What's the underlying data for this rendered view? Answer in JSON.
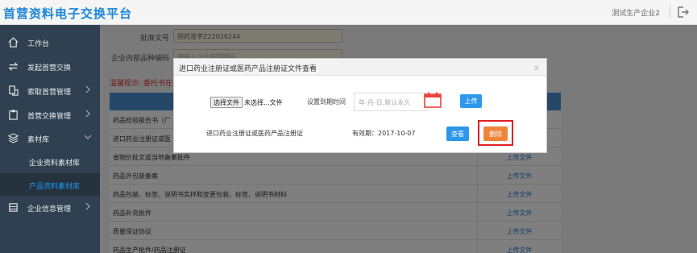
{
  "header": {
    "title": "首营资料电子交换平台",
    "user": "测试生产企业2",
    "logout_icon": "logout-icon"
  },
  "sidebar": {
    "items": [
      {
        "label": "工作台",
        "icon": "home-icon"
      },
      {
        "label": "发起首营交换",
        "icon": "exchange-icon"
      },
      {
        "label": "索取首营管理",
        "icon": "request-icon"
      },
      {
        "label": "首营交换管理",
        "icon": "clipboard-icon"
      },
      {
        "label": "素材库",
        "icon": "layers-icon"
      },
      {
        "label": "企业信息管理",
        "icon": "building-icon"
      }
    ],
    "sub_items": [
      {
        "label": "企业资料素材库"
      },
      {
        "label": "产品资料素材库"
      }
    ]
  },
  "form": {
    "approval_label": "批准文号",
    "approval_value": "国药准字Z22026244",
    "code_label": "企业内部品种编码",
    "code_placeholder": "请输入企业内部编码"
  },
  "warning": "温馨提示: 委托书在文",
  "table": {
    "rows": [
      {
        "name": "药品检验报告书（厂",
        "action": ""
      },
      {
        "name": "进口药业注册证或医",
        "action": ""
      },
      {
        "name": "省物价批文或当地备案批件",
        "action": "上传文件"
      },
      {
        "name": "药品外包装备案",
        "action": "上传文件"
      },
      {
        "name": "药品包装、标签、说明书实样和变更包装、标签、说明书材料",
        "action": "上传文件"
      },
      {
        "name": "药品补充批件",
        "action": "上传文件"
      },
      {
        "name": "质量保证协议",
        "action": "上传文件"
      },
      {
        "name": "药品生产批件/药品注册证",
        "action": "上传文件"
      }
    ]
  },
  "modal": {
    "title": "进口药业注册证或医药产品注册证文件查看",
    "close": "x",
    "choose_label": "选择文件",
    "no_file": "未选择...文件",
    "expire_label": "设置到期时间",
    "date_placeholder": "年-月-日,默认永久",
    "upload_label": "上传",
    "doc_name": "进口药业注册证或医药产品注册证",
    "valid_text": "有效期：2017-10-07",
    "view_label": "查看",
    "delete_label": "删除",
    "calendar_icon": "calendar-icon"
  },
  "colors": {
    "brand": "#1b85d8",
    "sidebar_bg": "#2f4050",
    "primary_btn": "#2d97ea",
    "delete_btn": "#f0853a",
    "highlight_frame": "#e02020"
  }
}
